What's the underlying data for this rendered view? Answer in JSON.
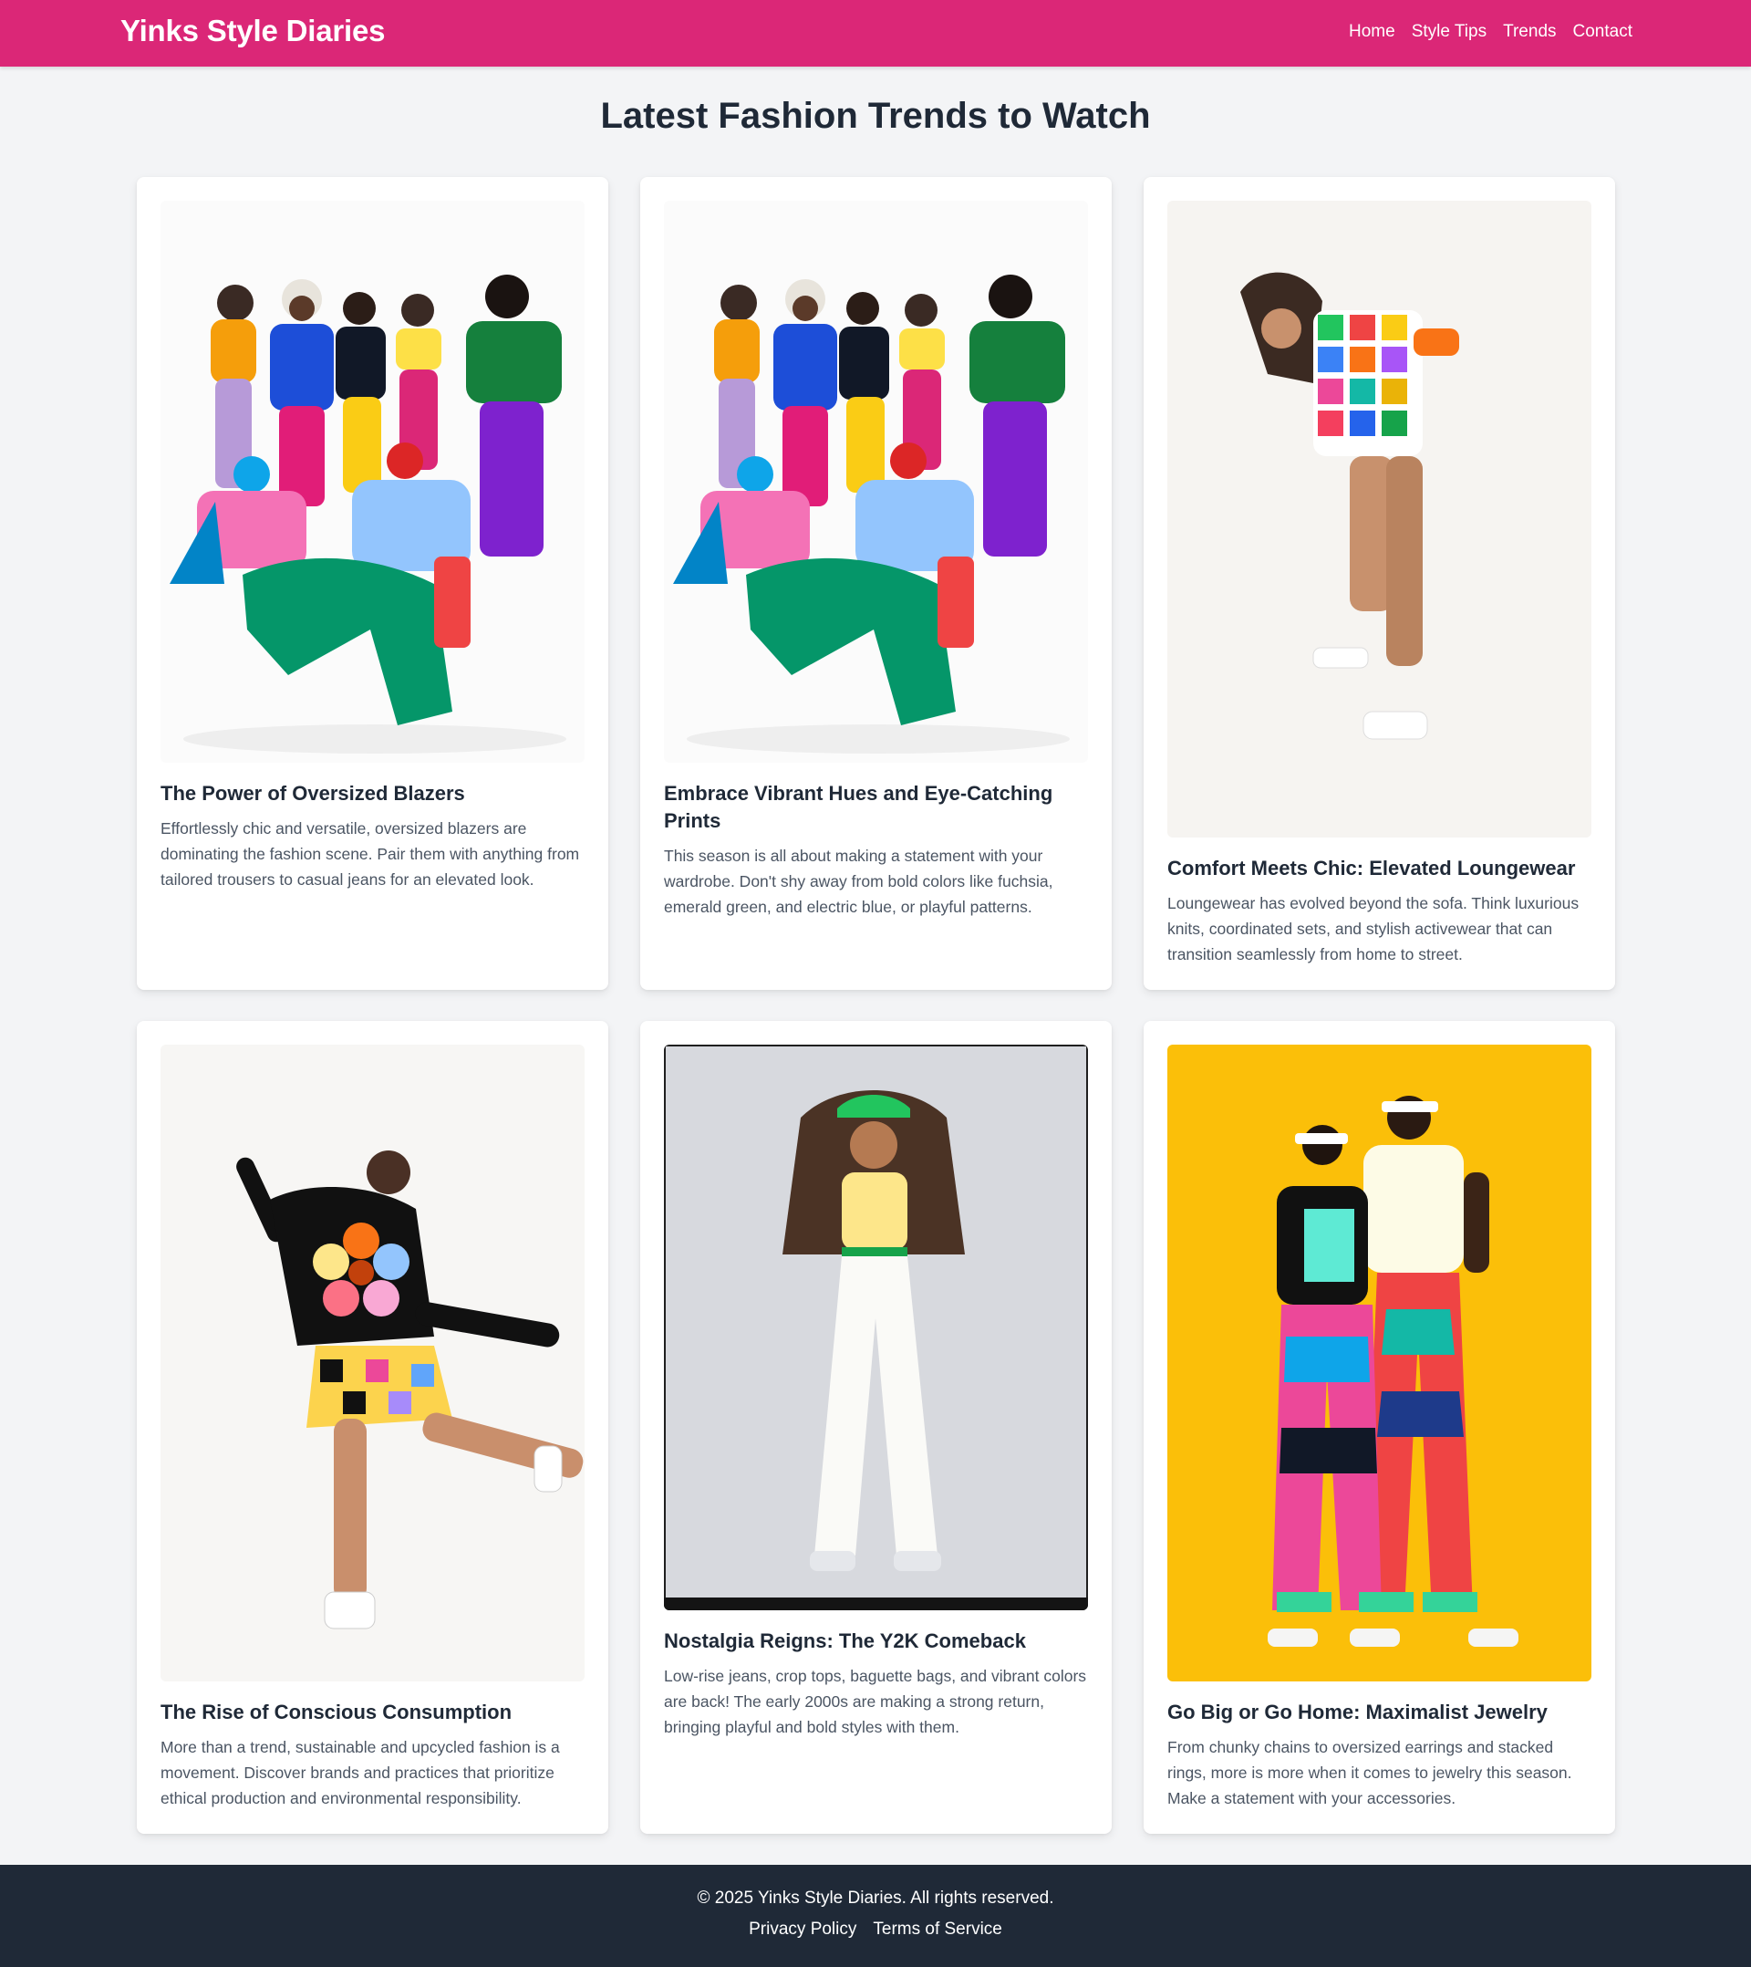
{
  "header": {
    "brand": "Yinks Style Diaries",
    "nav": [
      "Home",
      "Style Tips",
      "Trends",
      "Contact"
    ],
    "bg_color": "#db2777"
  },
  "main": {
    "title": "Latest Fashion Trends to Watch",
    "cards": [
      {
        "title": "The Power of Oversized Blazers",
        "text": "Effortlessly chic and versatile, oversized blazers are dominating the fashion scene. Pair them with anything from tailored trousers to casual jeans for an elevated look.",
        "image": "group-colorful-outfits-photo"
      },
      {
        "title": "Embrace Vibrant Hues and Eye-Catching Prints",
        "text": "This season is all about making a statement with your wardrobe. Don't shy away from bold colors like fuchsia, emerald green, and electric blue, or playful patterns.",
        "image": "group-colorful-outfits-photo"
      },
      {
        "title": "Comfort Meets Chic: Elevated Loungewear",
        "text": "Loungewear has evolved beyond the sofa. Think luxurious knits, coordinated sets, and stylish activewear that can transition seamlessly from home to street.",
        "image": "patchwork-loungewear-model-photo"
      },
      {
        "title": "The Rise of Conscious Consumption",
        "text": "More than a trend, sustainable and upcycled fashion is a movement. Discover brands and practices that prioritize ethical production and environmental responsibility.",
        "image": "flower-sweater-model-photo"
      },
      {
        "title": "Nostalgia Reigns: The Y2K Comeback",
        "text": "Low-rise jeans, crop tops, baguette bags, and vibrant colors are back! The early 2000s are making a strong return, bringing playful and bold styles with them.",
        "image": "y2k-white-jeans-model-photo"
      },
      {
        "title": "Go Big or Go Home: Maximalist Jewelry",
        "text": "From chunky chains to oversized earrings and stacked rings, more is more when it comes to jewelry this season. Make a statement with your accessories.",
        "image": "couple-patterned-overalls-photo"
      }
    ]
  },
  "footer": {
    "copyright": "© 2025 Yinks Style Diaries. All rights reserved.",
    "links": [
      "Privacy Policy",
      "Terms of Service"
    ],
    "bg_color": "#1f2937"
  }
}
